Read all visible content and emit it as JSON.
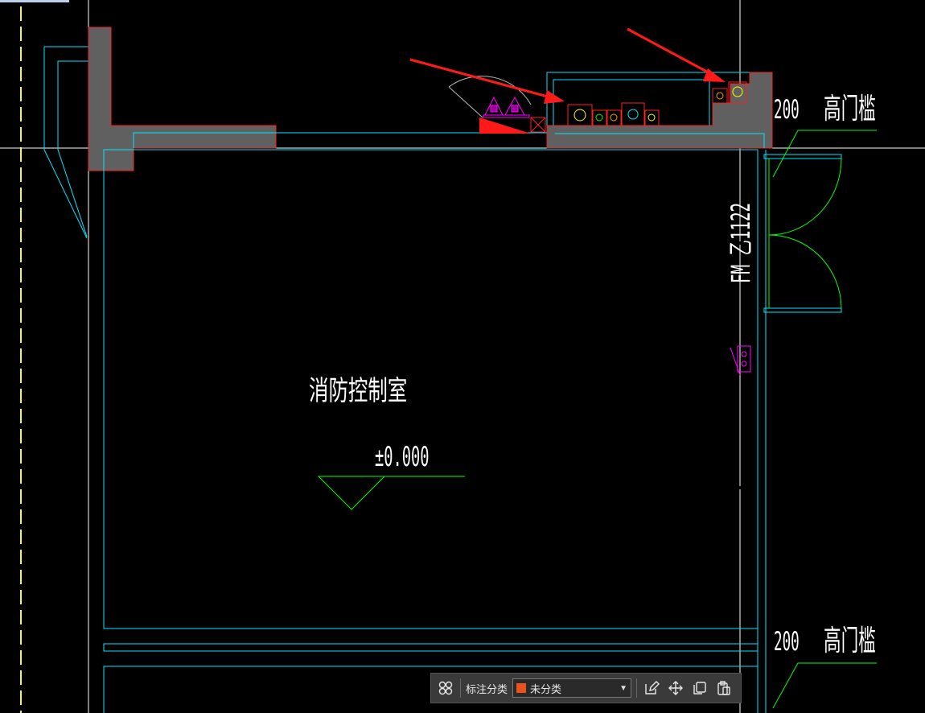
{
  "drawing": {
    "room_name": "消防控制室",
    "elevation": "±0.000",
    "door_label": "FM 乙1122",
    "threshold_top": {
      "number": "200",
      "text": "高门槛"
    },
    "threshold_bottom": {
      "number": "200",
      "text": "高门槛"
    }
  },
  "toolbar": {
    "category_label": "标注分类",
    "category_value": "未分类",
    "swatch_color": "#e8541e",
    "icons": [
      "grid-icon",
      "edit-icon",
      "move-icon",
      "copy-icon",
      "paste-icon"
    ]
  },
  "colors": {
    "background": "#000000",
    "wall_fill": "#606060",
    "wall_outline": "#ff2020",
    "cyan_line": "#00e5ff",
    "green_line": "#00ff00",
    "axis_yellow": "#ffff00",
    "magenta": "#ff00ff",
    "annotation_red": "#ff1a1a"
  }
}
